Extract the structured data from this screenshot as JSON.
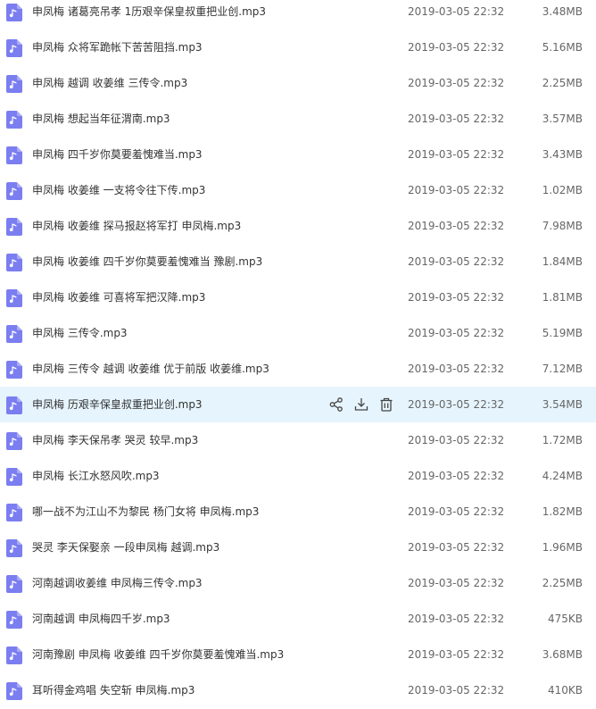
{
  "colors": {
    "icon_bg": "#7b7ef0",
    "hover_row_bg": "#e6f4fd",
    "action_icon": "#444444"
  },
  "icons": {
    "file": "music-note-icon",
    "actions": [
      "share-icon",
      "download-icon",
      "delete-icon"
    ]
  },
  "hovered_index": 11,
  "files": [
    {
      "name": "申凤梅 诸葛亮吊孝 1历艰辛保皇叔重把业创.mp3",
      "date": "2019-03-05 22:32",
      "size": "3.48MB"
    },
    {
      "name": "申凤梅 众将军跪帐下苦苦阻挡.mp3",
      "date": "2019-03-05 22:32",
      "size": "5.16MB"
    },
    {
      "name": "申凤梅 越调 收姜维 三传令.mp3",
      "date": "2019-03-05 22:32",
      "size": "2.25MB"
    },
    {
      "name": "申凤梅 想起当年征渭南.mp3",
      "date": "2019-03-05 22:32",
      "size": "3.57MB"
    },
    {
      "name": "申凤梅 四千岁你莫要羞愧难当.mp3",
      "date": "2019-03-05 22:32",
      "size": "3.43MB"
    },
    {
      "name": "申凤梅 收姜维 一支将令往下传.mp3",
      "date": "2019-03-05 22:32",
      "size": "1.02MB"
    },
    {
      "name": "申凤梅 收姜维 探马报赵将军打 申凤梅.mp3",
      "date": "2019-03-05 22:32",
      "size": "7.98MB"
    },
    {
      "name": "申凤梅 收姜维 四千岁你莫要羞愧难当 豫剧.mp3",
      "date": "2019-03-05 22:32",
      "size": "1.84MB"
    },
    {
      "name": "申凤梅 收姜维 可喜将军把汉降.mp3",
      "date": "2019-03-05 22:32",
      "size": "1.81MB"
    },
    {
      "name": "申凤梅 三传令.mp3",
      "date": "2019-03-05 22:32",
      "size": "5.19MB"
    },
    {
      "name": "申凤梅 三传令 越调 收姜维 优于前版 收姜维.mp3",
      "date": "2019-03-05 22:32",
      "size": "7.12MB"
    },
    {
      "name": "申凤梅 历艰辛保皇叔重把业创.mp3",
      "date": "2019-03-05 22:32",
      "size": "3.54MB"
    },
    {
      "name": "申凤梅 李天保吊孝 哭灵 较早.mp3",
      "date": "2019-03-05 22:32",
      "size": "1.72MB"
    },
    {
      "name": "申凤梅 长江水怒风吹.mp3",
      "date": "2019-03-05 22:32",
      "size": "4.24MB"
    },
    {
      "name": "哪一战不为江山不为黎民 杨门女将 申凤梅.mp3",
      "date": "2019-03-05 22:32",
      "size": "1.82MB"
    },
    {
      "name": "哭灵 李天保娶亲 一段申凤梅 越调.mp3",
      "date": "2019-03-05 22:32",
      "size": "1.96MB"
    },
    {
      "name": "河南越调收姜维 申凤梅三传令.mp3",
      "date": "2019-03-05 22:32",
      "size": "2.25MB"
    },
    {
      "name": "河南越调 申凤梅四千岁.mp3",
      "date": "2019-03-05 22:32",
      "size": "475KB"
    },
    {
      "name": "河南豫剧 申凤梅 收姜维 四千岁你莫要羞愧难当.mp3",
      "date": "2019-03-05 22:32",
      "size": "3.68MB"
    },
    {
      "name": "耳听得金鸡唱 失空斩 申凤梅.mp3",
      "date": "2019-03-05 22:32",
      "size": "410KB"
    }
  ]
}
